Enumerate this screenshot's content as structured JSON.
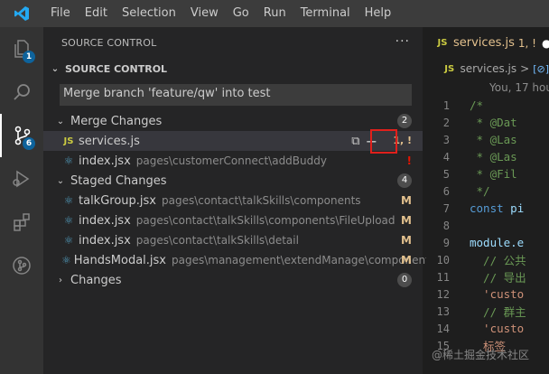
{
  "menubar": {
    "items": [
      "File",
      "Edit",
      "Selection",
      "View",
      "Go",
      "Run",
      "Terminal",
      "Help"
    ]
  },
  "activitybar": {
    "explorer_badge": "1",
    "scm_badge": "6"
  },
  "sidebar": {
    "header": "SOURCE CONTROL",
    "more": "···",
    "section_title": "SOURCE CONTROL",
    "commit_message": "Merge branch 'feature/qw' into test",
    "merge_changes": {
      "label": "Merge Changes",
      "count": "2",
      "files": [
        {
          "icon": "JS",
          "name": "services.js",
          "path": "",
          "status": "1, !"
        },
        {
          "icon": "⚛",
          "name": "index.jsx",
          "path": "pages\\customerConnect\\addBuddy",
          "status": "!"
        }
      ]
    },
    "staged_changes": {
      "label": "Staged Changes",
      "count": "4",
      "files": [
        {
          "icon": "⚛",
          "name": "talkGroup.jsx",
          "path": "pages\\contact\\talkSkills\\components",
          "status": "M"
        },
        {
          "icon": "⚛",
          "name": "index.jsx",
          "path": "pages\\contact\\talkSkills\\components\\FileUpload",
          "status": "M"
        },
        {
          "icon": "⚛",
          "name": "index.jsx",
          "path": "pages\\contact\\talkSkills\\detail",
          "status": "M"
        },
        {
          "icon": "⚛",
          "name": "HandsModal.jsx",
          "path": "pages\\management\\extendManage\\components",
          "status": "M"
        }
      ]
    },
    "changes": {
      "label": "Changes",
      "count": "0"
    }
  },
  "editor": {
    "tab": {
      "icon": "JS",
      "name": "services.js",
      "state": "1, !",
      "dot": "●"
    },
    "breadcrumb": {
      "icon": "JS",
      "file": "services.js",
      "sep": ">",
      "symbol": "[⊘]"
    },
    "blame": "You, 17 hou",
    "lines": [
      {
        "n": "1",
        "text": "/*"
      },
      {
        "n": "2",
        "text": " * @Dat"
      },
      {
        "n": "3",
        "text": " * @Las"
      },
      {
        "n": "4",
        "text": " * @Las"
      },
      {
        "n": "5",
        "text": " * @Fil"
      },
      {
        "n": "6",
        "text": " */"
      },
      {
        "n": "7",
        "text_kw": "const",
        "text": " pi"
      },
      {
        "n": "8",
        "text": ""
      },
      {
        "n": "9",
        "text": "module.e"
      },
      {
        "n": "10",
        "text": "  // 公共"
      },
      {
        "n": "11",
        "text": "  // 导出"
      },
      {
        "n": "12",
        "text": "  'custo"
      },
      {
        "n": "13",
        "text": "  // 群主"
      },
      {
        "n": "14",
        "text": "  'custo"
      },
      {
        "n": "15",
        "text": "  标签"
      }
    ]
  },
  "watermark": "@稀土掘金技术社区"
}
